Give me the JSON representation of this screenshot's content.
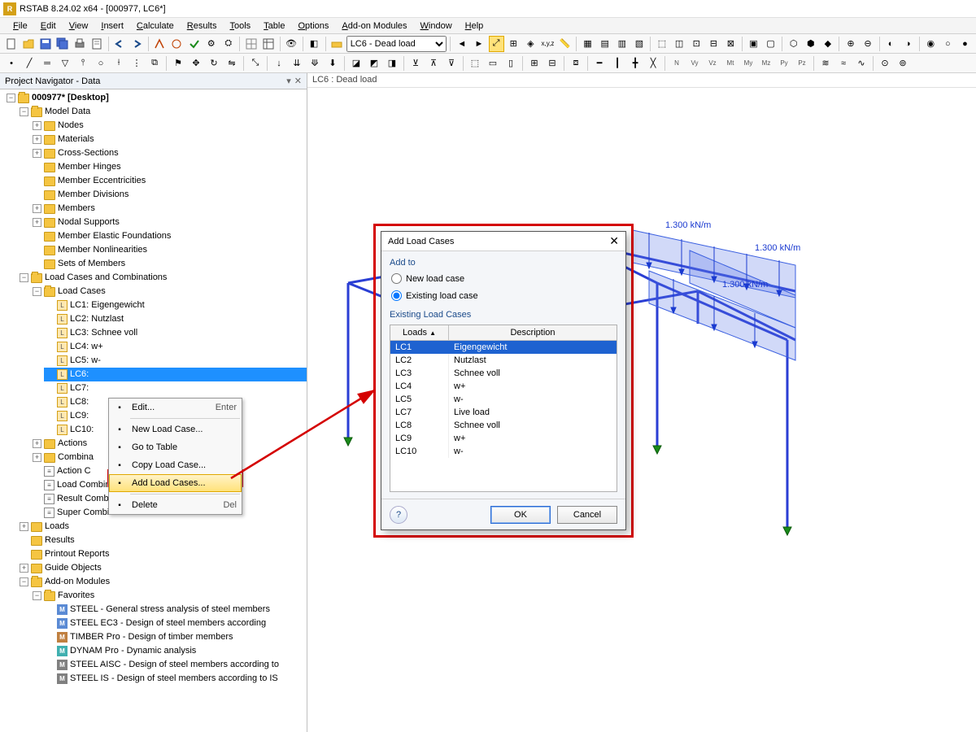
{
  "app": {
    "title": "RSTAB 8.24.02 x64 - [000977, LC6*]"
  },
  "menu": [
    "File",
    "Edit",
    "View",
    "Insert",
    "Calculate",
    "Results",
    "Tools",
    "Table",
    "Options",
    "Add-on Modules",
    "Window",
    "Help"
  ],
  "toolbar_combo": "LC6 - Dead load",
  "nav": {
    "title": "Project Navigator - Data",
    "root": "000977* [Desktop]",
    "model_data": {
      "label": "Model Data",
      "children": [
        "Nodes",
        "Materials",
        "Cross-Sections",
        "Member Hinges",
        "Member Eccentricities",
        "Member Divisions",
        "Members",
        "Nodal Supports",
        "Member Elastic Foundations",
        "Member Nonlinearities",
        "Sets of Members"
      ]
    },
    "lcc": {
      "label": "Load Cases and Combinations",
      "load_cases_label": "Load Cases",
      "load_cases": [
        "LC1: Eigengewicht",
        "LC2: Nutzlast",
        "LC3: Schnee voll",
        "LC4: w+",
        "LC5: w-",
        "LC6:",
        "LC7:",
        "LC8:",
        "LC9:",
        "LC10:"
      ],
      "selected_index": 5,
      "actions": "Actions",
      "combin": "Combina",
      "actionc": "Action C",
      "load_comb": "Load Combinations",
      "result_comb": "Result Combinations",
      "super_comb": "Super Combinations"
    },
    "loads": "Loads",
    "results": "Results",
    "printout": "Printout Reports",
    "guide": "Guide Objects",
    "addon": {
      "label": "Add-on Modules",
      "fav": "Favorites",
      "items": [
        "STEEL - General stress analysis of steel members",
        "STEEL EC3 - Design of steel members according",
        "TIMBER Pro - Design of timber members",
        "DYNAM Pro - Dynamic analysis",
        "STEEL AISC - Design of steel members according to",
        "STEEL IS - Design of steel members according to IS"
      ]
    }
  },
  "viewport": {
    "title": "LC6 : Dead load",
    "load_label": "1.300 kN/m"
  },
  "context_menu": {
    "items": [
      {
        "label": "Edit...",
        "shortcut": "Enter"
      },
      {
        "label": "New Load Case..."
      },
      {
        "label": "Go to Table"
      },
      {
        "label": "Copy Load Case..."
      },
      {
        "label": "Add Load Cases...",
        "highlight": true
      },
      {
        "label": "Delete",
        "shortcut": "Del"
      }
    ]
  },
  "dialog": {
    "title": "Add Load Cases",
    "group_addto": "Add to",
    "opt_new": "New load case",
    "opt_existing": "Existing load case",
    "group_list": "Existing Load Cases",
    "col_loads": "Loads",
    "col_desc": "Description",
    "rows": [
      {
        "lc": "LC1",
        "desc": "Eigengewicht",
        "sel": true
      },
      {
        "lc": "LC2",
        "desc": "Nutzlast"
      },
      {
        "lc": "LC3",
        "desc": "Schnee voll"
      },
      {
        "lc": "LC4",
        "desc": "w+"
      },
      {
        "lc": "LC5",
        "desc": "w-"
      },
      {
        "lc": "LC7",
        "desc": "Live load"
      },
      {
        "lc": "LC8",
        "desc": "Schnee voll"
      },
      {
        "lc": "LC9",
        "desc": "w+"
      },
      {
        "lc": "LC10",
        "desc": "w-"
      }
    ],
    "ok": "OK",
    "cancel": "Cancel"
  }
}
